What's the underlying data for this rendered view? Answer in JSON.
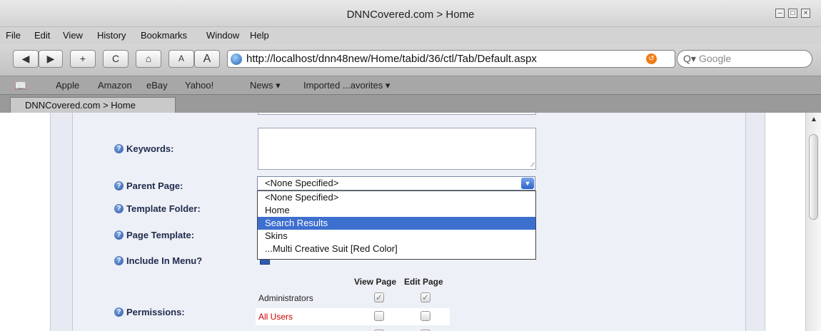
{
  "window": {
    "title": "DNNCovered.com > Home",
    "controls": [
      "–",
      "□",
      "×"
    ]
  },
  "menubar": [
    "File",
    "Edit",
    "View",
    "History",
    "Bookmarks",
    "Window",
    "Help"
  ],
  "toolbar": {
    "back": "◀",
    "forward": "▶",
    "add": "+",
    "reload": "C",
    "home": "⌂",
    "text_smaller": "A",
    "text_larger": "A",
    "url": "http://localhost/dnn48new/Home/tabid/36/ctl/Tab/Default.aspx",
    "search_placeholder": "Google"
  },
  "bookmarks": {
    "items": [
      "Apple",
      "Amazon",
      "eBay",
      "Yahoo!",
      "News ▾",
      "Imported ...avorites ▾"
    ]
  },
  "tab": {
    "label": "DNNCovered.com > Home"
  },
  "form": {
    "keywords_label": "Keywords:",
    "parent_page_label": "Parent Page:",
    "parent_page_value": "<None Specified>",
    "template_folder_label": "Template Folder:",
    "page_template_label": "Page Template:",
    "include_menu_label": "Include In Menu?",
    "permissions_label": "Permissions:",
    "dropdown_options": [
      "<None Specified>",
      "Home",
      "Search Results",
      "Skins",
      "...Multi Creative Suit [Red Color]"
    ],
    "dropdown_selected": "Search Results"
  },
  "permissions": {
    "columns": [
      "View Page",
      "Edit Page"
    ],
    "rows": [
      {
        "role": "Administrators",
        "view": "✓",
        "edit": "✓",
        "role_color": "#222222"
      },
      {
        "role": "All Users",
        "view": "",
        "edit": "",
        "role_color": "#cc0000"
      }
    ]
  }
}
